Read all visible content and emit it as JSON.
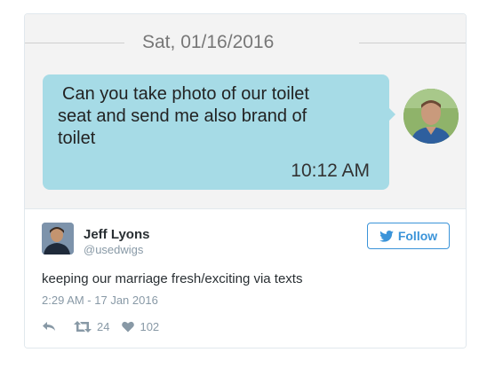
{
  "sms": {
    "date": "Sat, 01/16/2016",
    "message_lines": [
      "Can you take photo of our toilet",
      "seat and send me also brand of",
      "toilet"
    ],
    "time": "10:12 AM",
    "bubble_color": "#a6dbe6"
  },
  "tweet": {
    "author_name": "Jeff Lyons",
    "author_handle": "@usedwigs",
    "follow_label": "Follow",
    "text": "keeping our marriage fresh/exciting via texts",
    "timestamp": "2:29 AM - 17 Jan 2016",
    "retweet_count": "24",
    "like_count": "102",
    "accent_color": "#3b94d9",
    "icons": [
      "reply-icon",
      "retweet-icon",
      "heart-icon",
      "twitter-bird-icon"
    ]
  }
}
